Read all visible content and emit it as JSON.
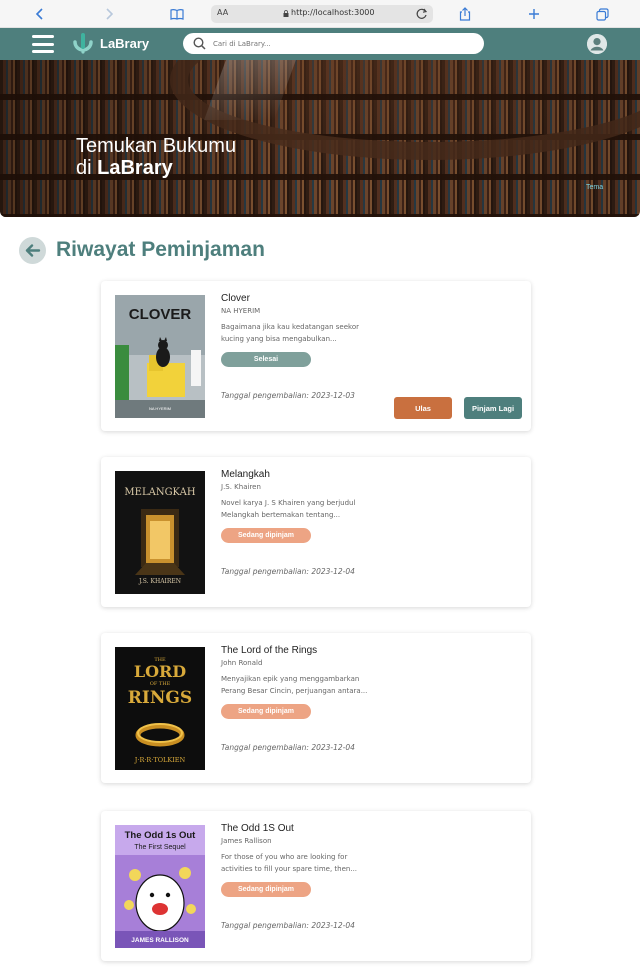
{
  "browser": {
    "text_size_label": "AA",
    "url": "http://localhost:3000"
  },
  "navbar": {
    "logo_text": "LaBrary",
    "search_placeholder": "Cari di LaBrary..."
  },
  "hero": {
    "title_line1": "Temukan Bukumu",
    "title_line2_prefix": "di ",
    "title_line2_brand": "LaBrary",
    "sign_text": "Tema"
  },
  "page": {
    "title": "Riwayat Peminjaman"
  },
  "colors": {
    "primary": "#4e7f7d",
    "status_done": "#7fa09b",
    "status_borrowed": "#eda484",
    "review_button": "#c9703f"
  },
  "history": [
    {
      "title": "Clover",
      "author": "NA HYERIM",
      "description_line1": "Bagaimana jika kau kedatangan seekor",
      "description_line2": "kucing yang bisa mengabulkan...",
      "status": "Selesai",
      "return_date": "Tanggal pengembalian: 2023-12-03",
      "review_label": "Ulas",
      "borrow_again_label": "Pinjam Lagi",
      "cover_text": "CLOVER",
      "cover_author": "NA HYERIM"
    },
    {
      "title": "Melangkah",
      "author": "J.S. Khairen",
      "description_line1": "Novel karya J. S Khairen yang berjudul",
      "description_line2": "Melangkah bertemakan tentang...",
      "status": "Sedang dipinjam",
      "return_date": "Tanggal pengembalian: 2023-12-04",
      "cover_text": "MELANGKAH",
      "cover_author": "J.S. KHAIREN"
    },
    {
      "title": "The Lord of the Rings",
      "author": "John Ronald",
      "description_line1": "Menyajikan epik yang menggambarkan",
      "description_line2": "Perang Besar Cincin, perjuangan antara...",
      "status": "Sedang dipinjam",
      "return_date": "Tanggal pengembalian: 2023-12-04",
      "cover_text_top": "THE",
      "cover_text_lord": "LORD",
      "cover_text_of": "OF THE",
      "cover_text_rings": "RINGS",
      "cover_author": "J·R·R·TOLKIEN"
    },
    {
      "title": "The Odd 1S Out",
      "author": "James Rallison",
      "description_line1": "For those of you who are looking for",
      "description_line2": "activities to fill your spare time, then...",
      "status": "Sedang dipinjam",
      "return_date": "Tanggal pengembalian: 2023-12-04",
      "cover_text": "The Odd 1s Out",
      "cover_subtitle": "The First Sequel",
      "cover_author": "JAMES RALLISON"
    }
  ]
}
